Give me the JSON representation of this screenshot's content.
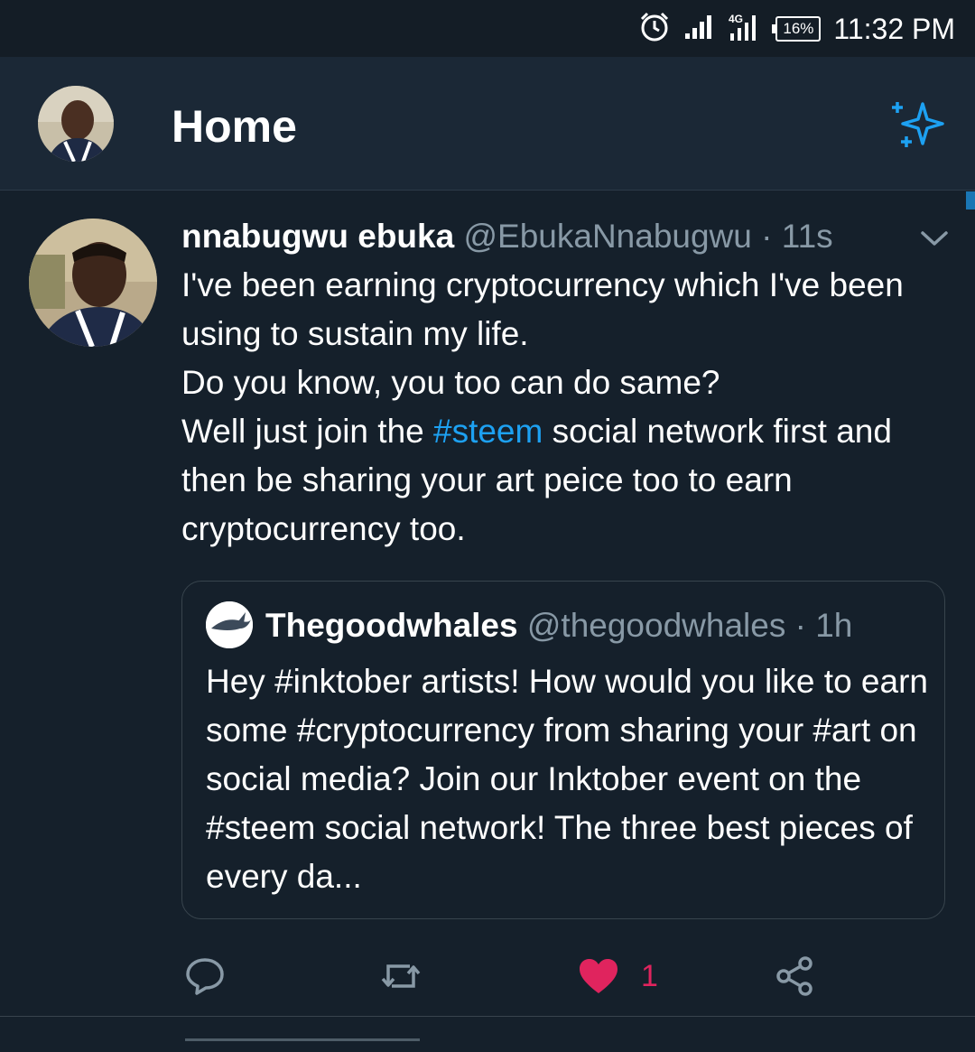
{
  "status_bar": {
    "time": "11:32 PM",
    "battery": "16%",
    "network": "4G",
    "icons": [
      "alarm-icon",
      "signal-icon",
      "4g-signal-icon",
      "battery-icon"
    ]
  },
  "header": {
    "title": "Home",
    "icons": [
      "profile-avatar",
      "sparkle-icon"
    ]
  },
  "tweet": {
    "display_name": "nnabugwu ebuka",
    "handle": "@EbukaNnabugwu",
    "separator": "·",
    "time": "11s",
    "lines": [
      "I've been earning cryptocurrency which I've been using to sustain my life.",
      "Do you know,  you too can do same?"
    ],
    "line3_before": "Well just join the ",
    "line3_hashtag": "#steem",
    "line3_after": " social network first and then be sharing your art peice too to earn cryptocurrency too.",
    "quote": {
      "display_name": "Thegoodwhales",
      "handle": "@thegoodwhales",
      "separator": "·",
      "time": "1h",
      "text": "Hey #inktober artists! How would you like to earn some #cryptocurrency from sharing your #art on social media? Join our Inktober event on the #steem social network! The three best pieces of every da..."
    },
    "actions": {
      "like_count": "1",
      "icons": [
        "reply-icon",
        "retweet-icon",
        "heart-icon",
        "share-icon"
      ]
    }
  },
  "colors": {
    "background": "#15202b",
    "header": "#1b2836",
    "accent": "#1da1f2",
    "like": "#e0245e",
    "muted": "#8899a6"
  }
}
